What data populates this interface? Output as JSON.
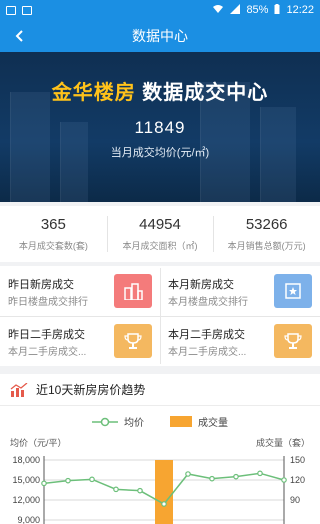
{
  "statusbar": {
    "battery": "85%",
    "time": "12:22"
  },
  "header": {
    "title": "数据中心"
  },
  "banner": {
    "brand": "金华楼房",
    "headline_rest": " 数据成交中心",
    "avg_price": "11849",
    "avg_price_label": "当月成交均价(元/㎡)"
  },
  "stats": [
    {
      "value": "365",
      "label": "本月成交套数(套)"
    },
    {
      "value": "44954",
      "label": "本月成交面积（㎡)"
    },
    {
      "value": "53266",
      "label": "本月销售总额(万元)"
    }
  ],
  "cards": [
    {
      "title": "昨日新房成交",
      "subtitle": "昨日楼盘成交排行",
      "icon": "buildings-icon",
      "color": "#f47b7b"
    },
    {
      "title": "本月新房成交",
      "subtitle": "本月楼盘成交排行",
      "icon": "star-badge-icon",
      "color": "#7db1ea"
    },
    {
      "title": "昨日二手房成交",
      "subtitle": "本月二手房成交...",
      "icon": "trophy-icon",
      "color": "#f4b860"
    },
    {
      "title": "本月二手房成交",
      "subtitle": "本月二手房成交...",
      "icon": "trophy-icon",
      "color": "#f4b860"
    }
  ],
  "trend": {
    "title": "近10天新房房价趋势",
    "legend_price": "均价",
    "legend_volume": "成交量",
    "left_axis_title": "均价（元/平）",
    "right_axis_title": "成交量（套）"
  },
  "chart_data": {
    "type": "bar",
    "series": [
      {
        "name": "均价",
        "type": "line",
        "values": [
          14500,
          14900,
          15100,
          13600,
          13400,
          11400,
          15900,
          15200,
          15500,
          16000,
          15000
        ]
      },
      {
        "name": "成交量",
        "type": "bar",
        "values": [
          0,
          0,
          0,
          0,
          0,
          150,
          0,
          0,
          0,
          0,
          0
        ]
      }
    ],
    "left_axis": {
      "ticks": [
        "18,000",
        "15,000",
        "12,000",
        "9,000"
      ],
      "ylim": [
        9000,
        18000
      ]
    },
    "right_axis": {
      "ticks": [
        "150",
        "120",
        "90"
      ],
      "ylim": [
        90,
        150
      ]
    },
    "grid": true,
    "colors": {
      "line": "#6cbf7a",
      "bar": "#f7a531"
    }
  },
  "colors": {
    "accent": "#1b8fe3"
  }
}
